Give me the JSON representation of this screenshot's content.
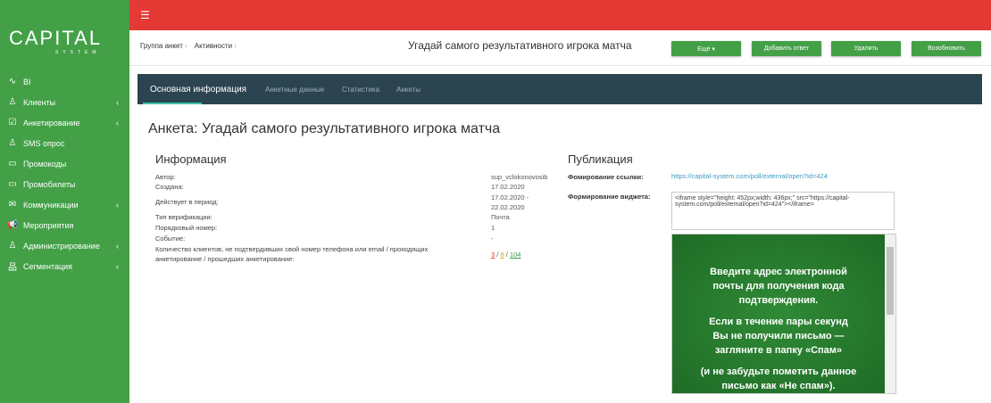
{
  "sidebar": {
    "logo": "CAPITAL",
    "logo_sub": "SYSTEM",
    "items": [
      {
        "label": "BI",
        "icon": "chart-line-icon",
        "chev": false
      },
      {
        "label": "Клиенты",
        "icon": "user-icon",
        "chev": true
      },
      {
        "label": "Анкетирование",
        "icon": "survey-icon",
        "chev": true
      },
      {
        "label": "SMS опрос",
        "icon": "user-icon",
        "chev": false
      },
      {
        "label": "Промокоды",
        "icon": "coupon-icon",
        "chev": false
      },
      {
        "label": "Промобилеты",
        "icon": "ticket-icon",
        "chev": false
      },
      {
        "label": "Коммуникации",
        "icon": "mail-icon",
        "chev": true
      },
      {
        "label": "Мероприятия",
        "icon": "megaphone-icon",
        "chev": false
      },
      {
        "label": "Администрирование",
        "icon": "user-icon",
        "chev": true
      },
      {
        "label": "Сегментация",
        "icon": "hierarchy-icon",
        "chev": true
      }
    ]
  },
  "header": {
    "crumbs": [
      "Группа анкет",
      "Активности"
    ],
    "title": "Угадай самого результативного игрока матча",
    "buttons": {
      "more": "Ещё ▾",
      "add_answer": "Добавить ответ",
      "delete": "Удалить",
      "resume": "Возобновить"
    }
  },
  "tabs": [
    "Основная информация",
    "Анкетные данные",
    "Статистика",
    "Анкеты"
  ],
  "page_title": "Анкета: Угадай самого результативного игрока матча",
  "info": {
    "heading": "Информация",
    "author_label": "Автор:",
    "author": "sup_vclokonovosib",
    "created_label": "Создана:",
    "created": "17.02.2020",
    "period_label": "Действует в период:",
    "period_from": "17.02.2020 -",
    "period_to": "22.02.2020",
    "verif_label": "Тип верификации:",
    "verif": "Почта",
    "order_label": "Порядковый номер:",
    "order": "1",
    "event_label": "Событие:",
    "event": "-",
    "count_label_1": "Количество клиентов, не подтвердивших свой номер телефона или email / проходящих",
    "count_label_2": "анкетирование / прошедших анкетирование:",
    "count_unconfirmed": "3",
    "count_in_progress": "8",
    "count_done": "104",
    "sep": " / "
  },
  "publication": {
    "heading": "Публикация",
    "link_label": "Фомирование ссылки:",
    "link": "https://capital-system.com/poll/external/open?id=424",
    "widget_label": "Формирование виджета:",
    "widget_code": "<iframe style=\"height: 452px;width: 436px;\" src=\"https://capital-system.com/poll/external/open?id=424\"></iframe>",
    "preview_1": "Введите адрес электронной почты для получения кода подтверждения.",
    "preview_2": "Если в течение пары секунд Вы не получили письмо — загляните в папку «Спам»",
    "preview_3": "(и не забудьте пометить данное письмо как «Не спам»)."
  },
  "colors": {
    "green": "#43a047",
    "red": "#e53935",
    "dark": "#2b4450"
  }
}
